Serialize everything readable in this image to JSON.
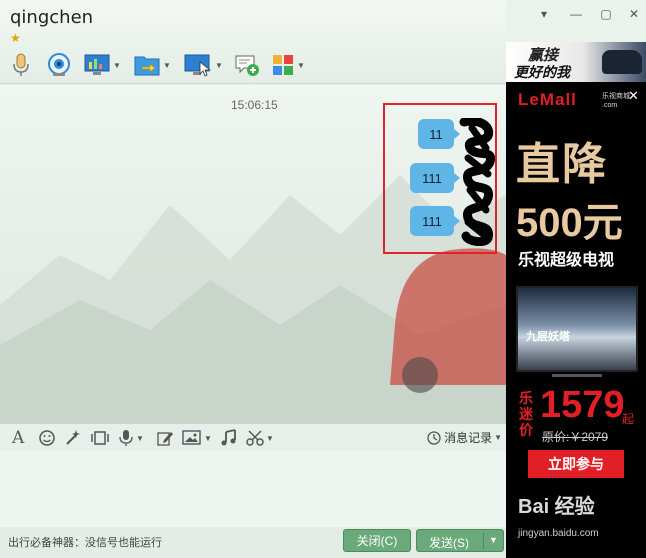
{
  "window": {
    "title": "qingchen",
    "controls": {
      "menu": "▾",
      "minimize": "—",
      "maximize": "▢",
      "close": "✕"
    }
  },
  "toolbar": {
    "items": [
      "microphone-icon",
      "video-camera-icon",
      "screen-share-icon",
      "file-transfer-icon",
      "remote-desktop-icon",
      "add-contact-icon",
      "apps-grid-icon"
    ]
  },
  "chat": {
    "timestamp": "15:06:15",
    "messages": [
      {
        "text": "11"
      },
      {
        "text": "111"
      },
      {
        "text": "111"
      }
    ]
  },
  "input_toolbar": {
    "history_label": "消息记录"
  },
  "bottom": {
    "tip": "出行必备神器：没信号也能运行",
    "close_label": "关闭(C)",
    "send_label": "发送(S)"
  },
  "ad_top": {
    "line1": "赢接",
    "line2": "更好的我"
  },
  "ad": {
    "logo": "LeMall",
    "logo_sub_1": "乐视商城",
    "logo_sub_2": ".com",
    "headline1": "直降",
    "headline2": "500元",
    "product": "乐视超级电视",
    "tv_caption": "九层妖塔",
    "price_prefix": "乐迷价",
    "price": "1579",
    "price_unit": "起",
    "original_price": "原价:￥2079",
    "cta": "立即参与",
    "watermark": "Bai 经验",
    "watermark_url": "jingyan.baidu.com"
  },
  "colors": {
    "bubble": "#5fb5e6",
    "highlight_frame": "#e0242a",
    "button_green": "#6aaa7a",
    "ad_red": "#e21f26"
  }
}
